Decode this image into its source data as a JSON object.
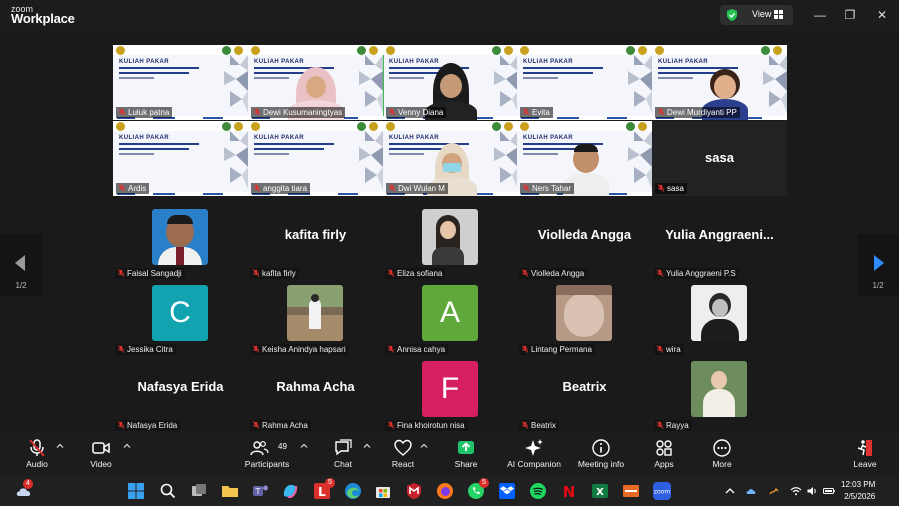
{
  "app": {
    "logo_top": "zoom",
    "logo_bottom": "Workplace"
  },
  "header": {
    "view_label": "View",
    "win_minimize": "—",
    "win_restore": "❐",
    "win_close": "✕"
  },
  "pager": {
    "left": "1/2",
    "right": "1/2"
  },
  "slide_title": "KULIAH PAKAR",
  "video_tiles": [
    {
      "name": "Luluk patna",
      "type": "slide",
      "person": "none"
    },
    {
      "name": "Dewi Kusumaningtyas",
      "type": "slide",
      "person": "hijab-pink"
    },
    {
      "name": "Venny Diana",
      "type": "slide",
      "person": "hijab-headset",
      "active": true
    },
    {
      "name": "Evita",
      "type": "slide",
      "person": "none"
    },
    {
      "name": "Dewi Murdiyanti PP",
      "type": "slide",
      "person": "woman-glasses"
    },
    {
      "name": "Ardis",
      "type": "slide",
      "person": "none"
    },
    {
      "name": "anggita tiara",
      "type": "slide",
      "person": "none"
    },
    {
      "name": "Dwi Wulan M",
      "type": "slide",
      "person": "hijab-mask"
    },
    {
      "name": "Ners Tahar",
      "type": "slide",
      "person": "man"
    },
    {
      "name": "sasa",
      "type": "name",
      "person": "none"
    }
  ],
  "participants": [
    {
      "display": "",
      "label": "Faisal Sangadji",
      "avatar": "photo-man-blue",
      "color": "#2a7fc9"
    },
    {
      "display": "kafita firly",
      "label": "kafita firly",
      "avatar": "none",
      "color": ""
    },
    {
      "display": "",
      "label": "Eliza sofiana",
      "avatar": "photo-girl",
      "color": "#cfcfcf"
    },
    {
      "display": "Violleda Angga",
      "label": "Violleda Angga",
      "avatar": "none",
      "color": ""
    },
    {
      "display": "Yulia Anggraeni...",
      "label": "Yulia Anggraeni P.S",
      "avatar": "none",
      "color": ""
    },
    {
      "display": "C",
      "label": "Jessika Citra",
      "avatar": "letter",
      "color": "#12a3b1"
    },
    {
      "display": "",
      "label": "Keisha Anindya hapsari",
      "avatar": "photo-outdoor",
      "color": "#7a6a55"
    },
    {
      "display": "A",
      "label": "Annisa cahya",
      "avatar": "letter",
      "color": "#5fa93b"
    },
    {
      "display": "",
      "label": "Lintang Permana",
      "avatar": "photo-blur",
      "color": "#b79a86"
    },
    {
      "display": "",
      "label": "wira",
      "avatar": "photo-bw",
      "color": "#eeeeee"
    },
    {
      "display": "Nafasya Erida",
      "label": "Nafasya Erida",
      "avatar": "none",
      "color": ""
    },
    {
      "display": "Rahma Acha",
      "label": "Rahma Acha",
      "avatar": "none",
      "color": ""
    },
    {
      "display": "F",
      "label": "Fina khoirotun nisa",
      "avatar": "letter",
      "color": "#d51f60"
    },
    {
      "display": "Beatrix",
      "label": "Beatrix",
      "avatar": "none",
      "color": ""
    },
    {
      "display": "",
      "label": "Rayya",
      "avatar": "photo-green",
      "color": "#5a7a4e"
    }
  ],
  "toolbar": {
    "audio": "Audio",
    "video": "Video",
    "participants": "Participants",
    "participants_count": "49",
    "chat": "Chat",
    "react": "React",
    "share": "Share",
    "ai": "AI Companion",
    "meeting_info": "Meeting info",
    "apps": "Apps",
    "more": "More",
    "leave": "Leave"
  },
  "colors": {
    "share_green": "#1fc46a",
    "leave_red": "#e0312e",
    "active_border": "#3dbd4f"
  },
  "taskbar": {
    "weather_badge": "4",
    "l_badge": "5",
    "whatsapp_badge": "5",
    "time": "12:03 PM",
    "date": "2/5/2026"
  }
}
